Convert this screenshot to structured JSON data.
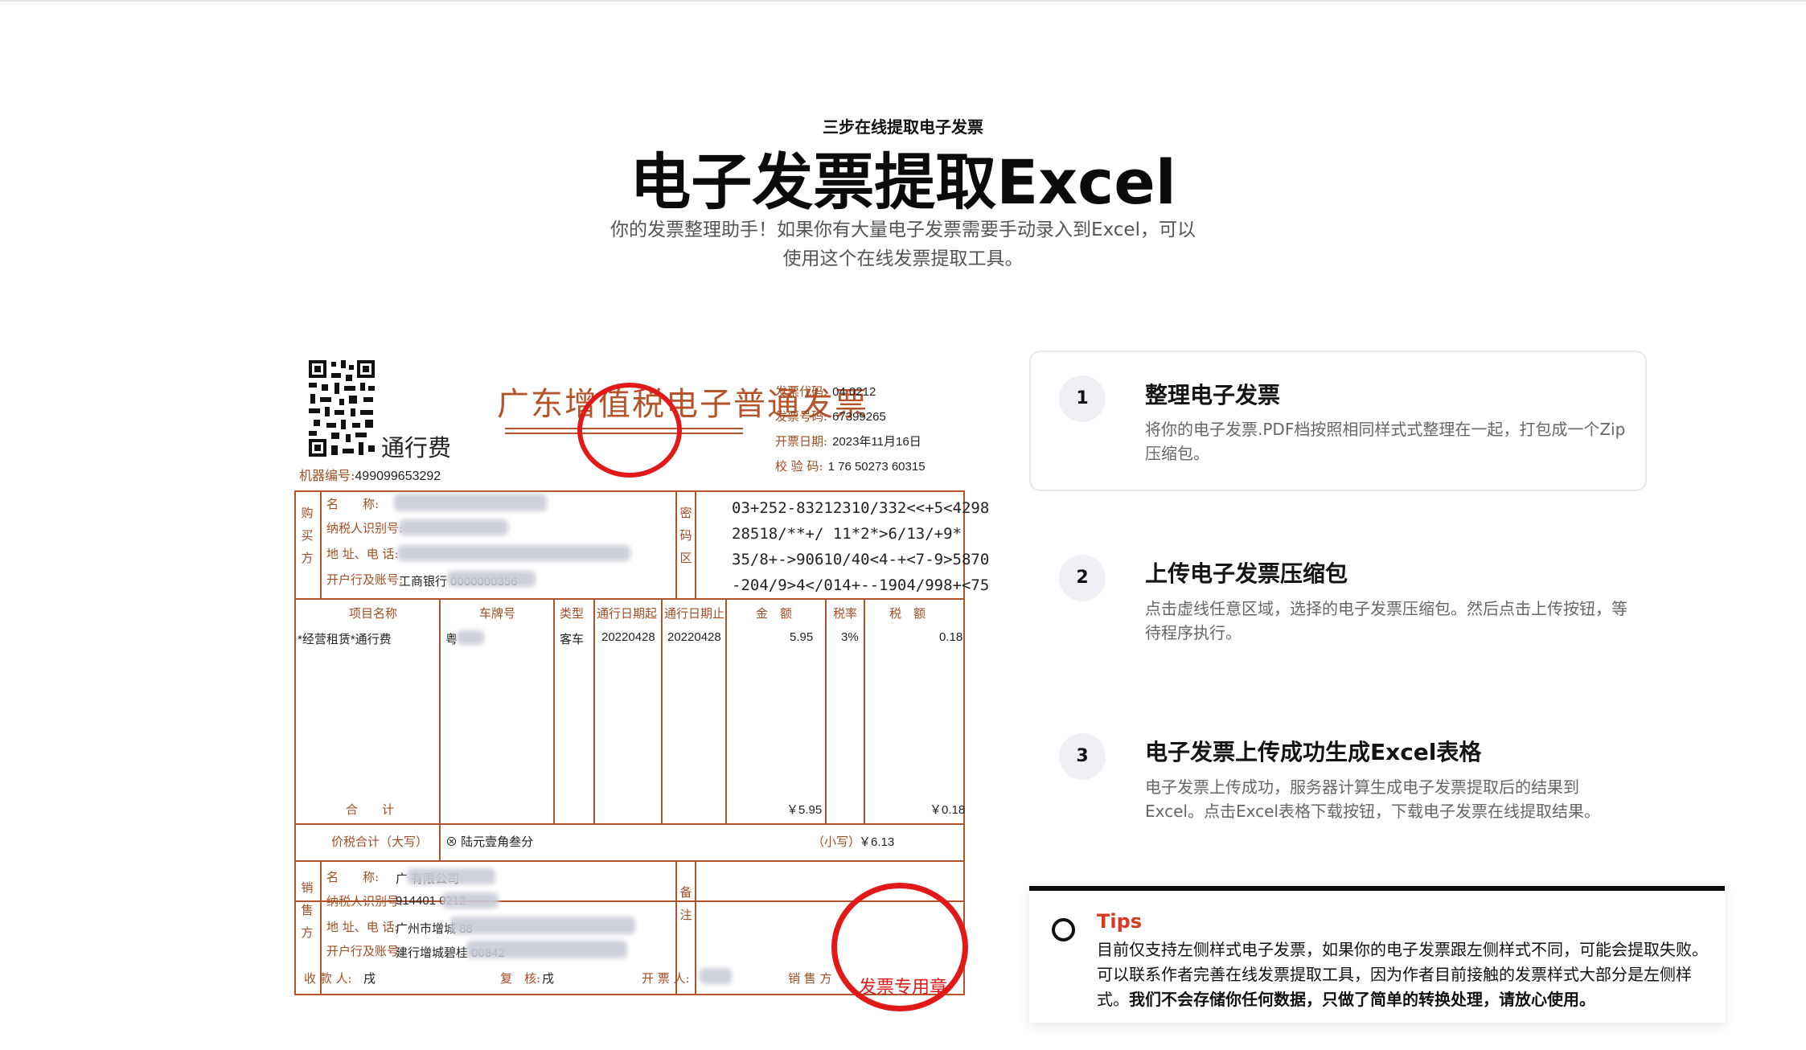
{
  "hero": {
    "eyebrow": "三步在线提取电子发票",
    "title": "电子发票提取Excel",
    "subtitle_line1": "你的发票整理助手！如果你有大量电子发票需要手动录入到Excel，可以",
    "subtitle_line2": "使用这个在线发票提取工具。"
  },
  "steps": [
    {
      "number": "1",
      "title": "整理电子发票",
      "desc": "将你的电子发票.PDF档按照相同样式式整理在一起，打包成一个Zip压缩包。"
    },
    {
      "number": "2",
      "title": "上传电子发票压缩包",
      "desc": "点击虚线任意区域，选择的电子发票压缩包。然后点击上传按钮，等待程序执行。"
    },
    {
      "number": "3",
      "title": "电子发票上传成功生成Excel表格",
      "desc": "电子发票上传成功，服务器计算生成电子发票提取后的结果到Excel。点击Excel表格下载按钮，下载电子发票在线提取结果。"
    }
  ],
  "tips": {
    "title": "Tips",
    "body": "目前仅支持左侧样式电子发票，如果你的电子发票跟左侧样式不同，可能会提取失败。可以联系作者完善在线发票提取工具，因为作者目前接触的发票样式大部分是左侧样式。",
    "body_strong": "我们不会存储你任何数据，只做了简单的转换处理，请放心使用。"
  },
  "invoice": {
    "title": "广东增值税电子普通发票",
    "category": "通行费",
    "machine_label": "机器编号:",
    "machine_no": "499099653292",
    "code_label": "发票代码:",
    "code_value": "04   0212",
    "number_label": "发票号码:",
    "number_value": "67399265",
    "date_label": "开票日期:",
    "date_value": "2023年11月16日",
    "check_label": "校 验 码:",
    "check_value": "1   76 50273 60315",
    "buyer_side": "购买方",
    "buyer_name_label": "名　　称:",
    "buyer_taxid_label": "纳税人识别号:",
    "buyer_addr_label": "地 址、电 话:",
    "buyer_bank_label": "开户行及账号:",
    "buyer_bank_value": "工商银行   0000000356",
    "cipher_side": "密码区",
    "cipher_lines": [
      "03+252-83212310/332<<+5<4298",
      "28518/**+/   11*2*>6/13/+9*",
      "35/8+->90610/40<4-+<7-9>5870",
      "-204/9>4</014+--1904/998+<75"
    ],
    "col_item": "项目名称",
    "col_plate": "车牌号",
    "col_type": "类型",
    "col_start": "通行日期起",
    "col_end": "通行日期止",
    "col_amount": "金　额",
    "col_rate": "税率",
    "col_tax": "税　额",
    "row_item": "*经营租赁*通行费",
    "row_plate": "粤",
    "row_type": "客车",
    "row_start": "20220428",
    "row_end": "20220428",
    "row_amount": "5.95",
    "row_rate": "3%",
    "row_tax": "0.18",
    "total_label": "合　　计",
    "total_amount": "￥5.95",
    "total_tax": "￥0.18",
    "sum_label": "价税合计（大写）",
    "sum_cn": "陆元壹角叁分",
    "sum_small_label": "（小写）",
    "sum_small": "￥6.13",
    "seller_side": "销售方",
    "seller_name_label": "名　　称:",
    "seller_name_value": "广   有限公司",
    "seller_taxid_label": "纳税人识别号:",
    "seller_taxid_value": "914401   0212",
    "seller_addr_label": "地 址、电 话:",
    "seller_addr_value": "广州市增城   88",
    "seller_bank_label": "开户行及账号:",
    "seller_bank_value": "建行增城碧桂   00842",
    "remark_side": "备注",
    "payee_label": "收 款 人:",
    "payee_value": "戌",
    "reviewer_label": "复　核:",
    "reviewer_value": "戌",
    "drawer_label": "开 票 人:",
    "seller_label": "销 售 方",
    "stamp_text": "发票专用章"
  },
  "colors": {
    "accent_tips": "#d63a22",
    "invoice_line": "#b5532a",
    "stamp_red": "#e21919",
    "step_badge_bg": "#eef0f5"
  }
}
